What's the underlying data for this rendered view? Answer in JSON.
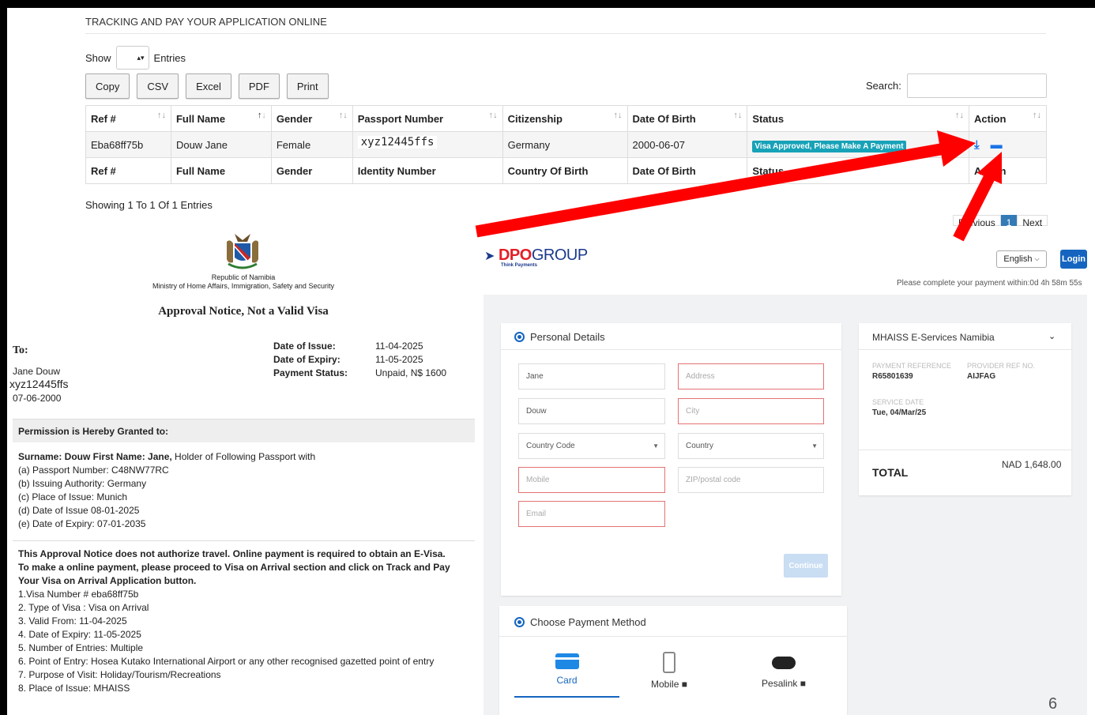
{
  "portal": {
    "title": "TRACKING AND PAY YOUR APPLICATION ONLINE",
    "show_label": "Show",
    "entries_label": "Entries",
    "buttons": [
      "Copy",
      "CSV",
      "Excel",
      "PDF",
      "Print"
    ],
    "search_label": "Search:",
    "table": {
      "headers": [
        "Ref #",
        "Full Name",
        "Gender",
        "Passport Number",
        "Citizenship",
        "Date Of Birth",
        "Status",
        "Action"
      ],
      "row": {
        "ref": "Eba68ff75b",
        "full_name": "Douw Jane",
        "gender": "Female",
        "passport": "xyz12445ffs",
        "citizenship": "Germany",
        "dob": "2000-06-07",
        "status": "Visa Approved, Please Make A Payment"
      },
      "footers": [
        "Ref #",
        "Full Name",
        "Gender",
        "Identity Number",
        "Country Of Birth",
        "Date Of Birth",
        "Status",
        "Action"
      ]
    },
    "showing": "Showing 1 To 1 Of 1 Entries",
    "pager": {
      "prev": "Previous",
      "page": "1",
      "next": "Next"
    }
  },
  "notice": {
    "republic": "Republic of Namibia",
    "ministry": "Ministry of Home Affairs, Immigration, Safety and Security",
    "title": "Approval Notice, Not a Valid Visa",
    "to": "To:",
    "name": "Jane Douw",
    "passport": "xyz12445ffs",
    "dob": "07-06-2000",
    "date_labels": [
      "Date of Issue:",
      "Date of Expiry:",
      "Payment Status:"
    ],
    "date_values": [
      "11-04-2025",
      "11-05-2025",
      "Unpaid, N$ 1600"
    ],
    "permission": "Permission is Hereby Granted to:",
    "holder_bold": "Surname: Douw First Name: Jane,",
    "holder_rest": " Holder of Following Passport with",
    "passport_items": [
      "(a) Passport Number: C48NW77RC",
      "(b) Issuing Authority: Germany",
      "(c) Place of Issue: Munich",
      "(d) Date of Issue 08-01-2025",
      "(e) Date of Expiry: 07-01-2035"
    ],
    "bold_lines": [
      "This Approval Notice does not authorize travel. Online payment is required to obtain an E-Visa.",
      "To make a online payment, please proceed to Visa on Arrival section and click on Track and Pay",
      "Your Visa on Arrival Application button."
    ],
    "visa_items": [
      "1.Visa Number # eba68ff75b",
      "2. Type of Visa : Visa on Arrival",
      "3. Valid From: 11-04-2025",
      "4. Date of Expiry: 11-05-2025",
      "5. Number of Entries: Multiple",
      "6. Point of Entry: Hosea Kutako International Airport or any other recognised gazetted point of entry",
      "7. Purpose of Visit: Holiday/Tourism/Recreations",
      "8. Place of Issue: MHAISS"
    ]
  },
  "dpo": {
    "logo_dpo": "DPO",
    "logo_group": "GROUP",
    "tagline": "Think Payments",
    "language": "English",
    "login": "Login",
    "timer": "Please complete your payment within:0d 4h 58m 55s",
    "personal_details": "Personal Details",
    "fields": {
      "first": "Jane",
      "last": "Douw",
      "address": "Address",
      "city": "City",
      "country_code": "Country Code",
      "country": "Country",
      "mobile": "Mobile",
      "zip": "ZIP/postal code",
      "email": "Email"
    },
    "continue": "Continue",
    "merchant": "MHAISS E-Services Namibia",
    "payment_ref_label": "PAYMENT REFERENCE",
    "payment_ref": "R65801639",
    "provider_ref_label": "PROVIDER REF NO.",
    "provider_ref": "AIJFAG",
    "service_date_label": "SERVICE DATE",
    "service_date": "Tue, 04/Mar/25",
    "total_label": "TOTAL",
    "total_amount": "NAD 1,648.00",
    "choose_method": "Choose Payment Method",
    "methods": [
      "Card",
      "Mobile",
      "Pesalink"
    ]
  },
  "page_number": "6",
  "colors": {
    "arrow": "#ff0000",
    "badge": "#17a2b8",
    "dpo_blue": "#1b3a8c",
    "dpo_red": "#e41e26",
    "login": "#1565c0"
  }
}
